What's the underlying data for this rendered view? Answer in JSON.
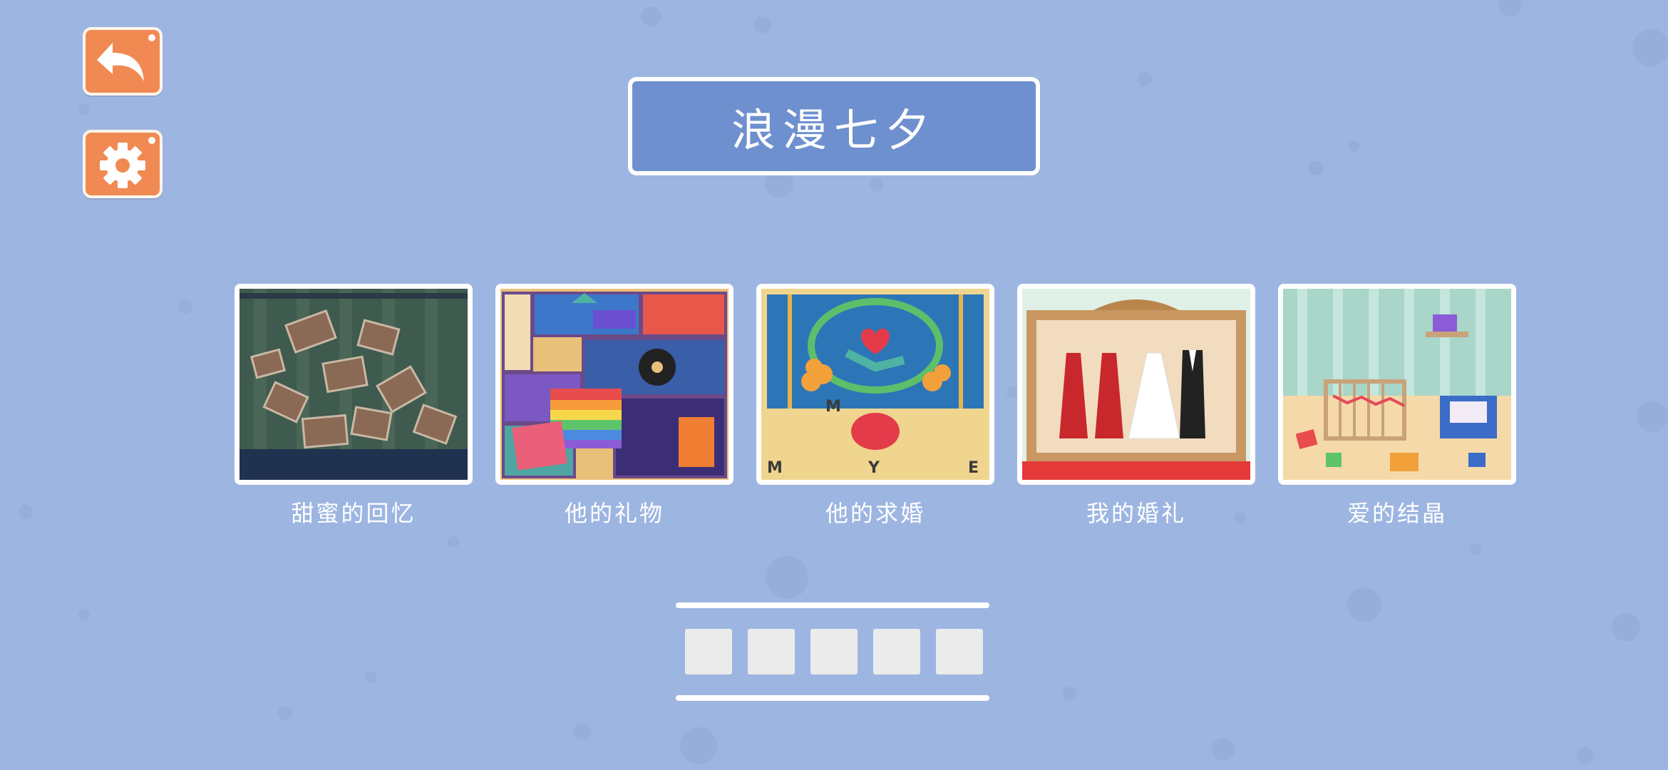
{
  "game": {
    "title": "浪漫七夕",
    "header": {
      "back_icon": "back-arrow-icon",
      "settings_icon": "gear-icon",
      "button_color": "#f08a52"
    },
    "levels": [
      {
        "label": "甜蜜的回忆",
        "scene": "photo-wall"
      },
      {
        "label": "他的礼物",
        "scene": "gift-boxes"
      },
      {
        "label": "他的求婚",
        "scene": "proposal-stage"
      },
      {
        "label": "我的婚礼",
        "scene": "wedding-dresses"
      },
      {
        "label": "爱的结晶",
        "scene": "nursery-room"
      }
    ],
    "pager": {
      "pages": 5
    },
    "colors": {
      "background": "#9db5e1",
      "title_box": "#6e90cf",
      "accent": "#f08a52"
    }
  }
}
